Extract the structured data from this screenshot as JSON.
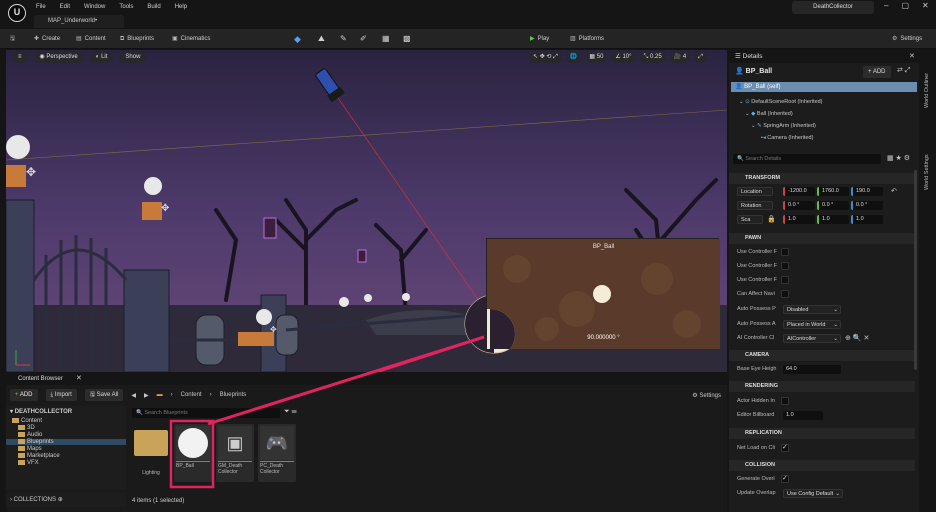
{
  "app": {
    "logo": "unreal-logo",
    "menu": [
      "File",
      "Edit",
      "Window",
      "Tools",
      "Build",
      "Help"
    ],
    "map_tab": "MAP_Underworld•",
    "project_name": "DeathCollector"
  },
  "toolbar": {
    "create": "Create",
    "content": "Content",
    "blueprints": "Blueprints",
    "cinematics": "Cinematics",
    "play": "Play",
    "platforms": "Platforms",
    "settings": "Settings"
  },
  "viewport": {
    "perspective": "Perspective",
    "lit": "Lit",
    "show": "Show",
    "grid_snap": "50",
    "rot_snap": "10°",
    "scale_snap": "0.25",
    "cam_speed": "4",
    "preview_title": "BP_Ball",
    "preview_value": "90.000000 °"
  },
  "content_browser": {
    "tab": "Content Browser",
    "add": "ADD",
    "import": "Import",
    "save_all": "Save All",
    "path": [
      "Content",
      "Blueprints"
    ],
    "settings": "Settings",
    "root": "DEATHCOLLECTOR",
    "search_placeholder": "Search Blueprints",
    "tree": [
      "Content",
      "3D",
      "Audio",
      "Blueprints",
      "Maps",
      "Marketplace",
      "VFX"
    ],
    "collections": "COLLECTIONS",
    "assets": [
      {
        "name": "Lighting"
      },
      {
        "name": "BP_Ball"
      },
      {
        "name": "GM_Death Collector"
      },
      {
        "name": "PC_Death Collector"
      }
    ],
    "count": "4 items (1 selected)"
  },
  "details": {
    "tab": "Details",
    "object": "BP_Ball",
    "add": "ADD",
    "self": "BP_Ball (self)",
    "components": [
      "DefaultSceneRoot (Inherited)",
      "Ball (Inherited)",
      "SpringArm (Inherited)",
      "Camera (Inherited)"
    ],
    "search_placeholder": "Search Details",
    "sections": {
      "transform": "TRANSFORM",
      "pawn": "PAWN",
      "camera": "CAMERA",
      "rendering": "RENDERING",
      "replication": "REPLICATION",
      "collision": "COLLISION"
    },
    "transform": {
      "location_label": "Location",
      "rotation_label": "Rotation",
      "scale_label": "Sca",
      "location": [
        "-1200.0",
        "1760.0",
        "190.0"
      ],
      "rotation": [
        "0.0 °",
        "0.0 °",
        "0.0 °"
      ],
      "scale": [
        "1.0",
        "1.0",
        "1.0"
      ]
    },
    "pawn": {
      "labels": [
        "Use Controller F",
        "Use Controller F",
        "Use Controller F",
        "Can Affect Navi",
        "Auto Possess P",
        "Auto Possess A",
        "AI Controller Cl"
      ],
      "auto_possess_player": "Disabled",
      "auto_possess_ai": "Placed in World",
      "ai_controller": "AIController"
    },
    "camera": {
      "label": "Base Eye Heigh",
      "value": "64.0"
    },
    "rendering": {
      "hidden_label": "Actor Hidden In",
      "billboard_label": "Editor Billboard",
      "billboard_value": "1.0"
    },
    "replication": {
      "label": "Net Load on Cli"
    },
    "collision": {
      "gen_label": "Generate Overl",
      "update_label": "Update Overlap",
      "update_value": "Use Config Default"
    }
  },
  "side_tabs": [
    "World Outliner",
    "World Settings"
  ]
}
